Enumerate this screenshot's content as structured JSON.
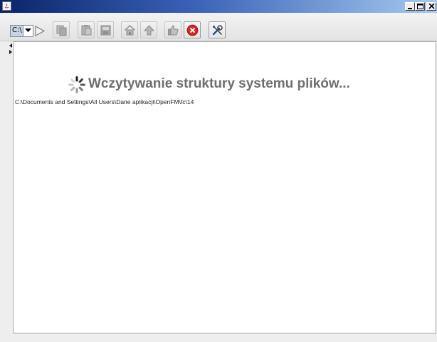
{
  "window": {
    "title": ""
  },
  "toolbar": {
    "drive_label": "C:\\",
    "buttons": [
      {
        "name": "play-icon"
      },
      {
        "name": "copy-icon"
      },
      {
        "name": "paste-icon"
      },
      {
        "name": "disk-icon"
      },
      {
        "name": "home-icon"
      },
      {
        "name": "up-arrow-icon"
      },
      {
        "name": "thumbs-up-icon"
      },
      {
        "name": "stop-icon"
      },
      {
        "name": "tools-icon"
      }
    ]
  },
  "main": {
    "loading_text": "Wczytywanie struktury systemu plików...",
    "path_text": "C:\\Documents and Settings\\All Users\\Dane aplikacji\\OpenFM\\fc\\14"
  },
  "colors": {
    "titlebar_start": "#0a246a",
    "titlebar_end": "#a6caf0",
    "loading_text": "#6e6e6e",
    "stop_red": "#d9261c"
  }
}
